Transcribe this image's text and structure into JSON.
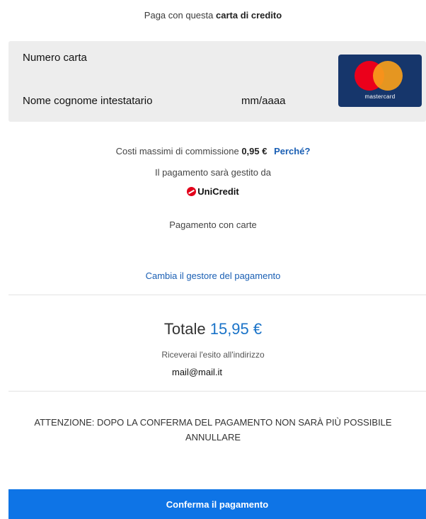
{
  "header": {
    "prefix": "Paga con questa",
    "bold": "carta di credito"
  },
  "card": {
    "number_label": "Numero carta",
    "holder_label": "Nome cognome intestatario",
    "expiry_label": "mm/aaaa",
    "brand": "mastercard"
  },
  "fee": {
    "label": "Costi massimi di commissione",
    "amount": "0,95 €",
    "why_link": "Perché?"
  },
  "managed_by": "Il pagamento sarà gestito da",
  "provider": "UniCredit",
  "payment_type": "Pagamento con carte",
  "change_provider": "Cambia il gestore del pagamento",
  "total": {
    "label": "Totale",
    "amount": "15,95 €"
  },
  "receipt": {
    "label": "Riceverai l'esito all'indirizzo",
    "email": "mail@mail.it"
  },
  "warning": {
    "line1": "ATTENZIONE: DOPO LA CONFERMA DEL PAGAMENTO NON SARÀ PIÙ POSSIBILE",
    "line2": "ANNULLARE"
  },
  "confirm_button": "Conferma il pagamento",
  "colors": {
    "accent": "#0e74e6",
    "link": "#1a5fb4",
    "card_bg": "#ededed"
  }
}
